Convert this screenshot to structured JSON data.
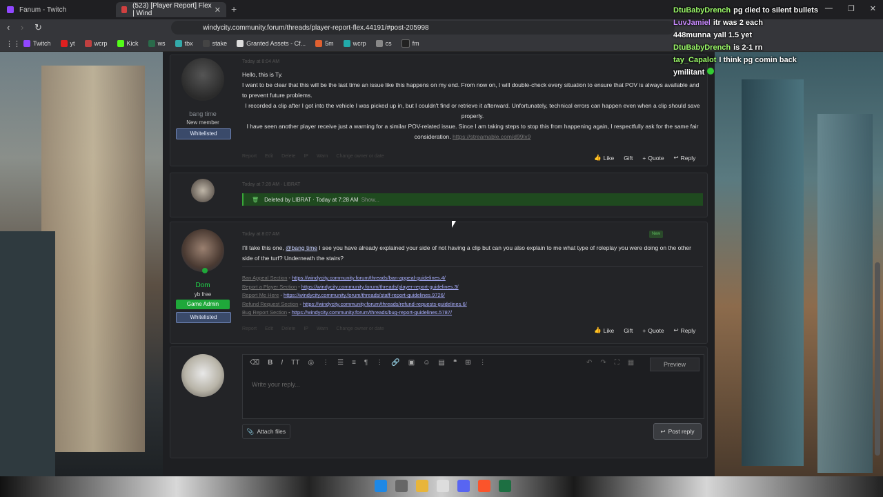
{
  "browser": {
    "tabs": [
      {
        "label": "Fanum - Twitch",
        "color": "#9147ff"
      },
      {
        "label": "(523) [Player Report] Flex | Wind",
        "color": "#d04040"
      }
    ],
    "url": "windycity.community.forum/threads/player-report-flex.44191/#post-205998",
    "bookmarks": [
      {
        "label": "Twitch",
        "color": "#9147ff"
      },
      {
        "label": "yt",
        "color": "#e02020"
      },
      {
        "label": "wcrp",
        "color": "#c04040"
      },
      {
        "label": "Kick",
        "color": "#53fc18"
      },
      {
        "label": "ws",
        "color": "#2a6a4a"
      },
      {
        "label": "tbx",
        "color": "#3aa"
      },
      {
        "label": "stake",
        "color": "#444"
      },
      {
        "label": "Granted Assets - Cf...",
        "color": "#ddd"
      },
      {
        "label": "5m",
        "color": "#e06030"
      },
      {
        "label": "wcrp",
        "color": "#2aa"
      },
      {
        "label": "cs",
        "color": "#888"
      },
      {
        "label": "fm",
        "color": "#222"
      }
    ]
  },
  "posts": [
    {
      "username": "bang time",
      "user_title": "New member",
      "badge": "Whitelisted",
      "meta": "Today at 8:04 AM",
      "paragraphs": [
        "Hello, this is Ty.",
        "I want to be clear that this will be the last time an issue like this happens on my end. From now on, I will double-check every situation to ensure that POV is always available and to prevent future problems.",
        "I recorded a clip after I got into the vehicle I was picked up in, but I couldn't find or retrieve it afterward. Unfortunately, technical errors can happen even when a clip should save properly.",
        "I have seen another player receive just a warning for a similar POV-related issue. Since I am taking steps to stop this from happening again, I respectfully ask for the same fair consideration."
      ],
      "link": "https://streamable.com/d99lx9",
      "small_links": [
        "Report",
        "Edit",
        "Delete",
        "IP",
        "Warn",
        "Change owner or date"
      ],
      "actions": [
        "Like",
        "Gift",
        "Quote",
        "Reply"
      ]
    },
    {
      "meta": "Today at 7:28 AM · LIBRAT",
      "deleted_text": "Deleted by LIBRAT · Today at 7:28 AM",
      "show": "Show..."
    },
    {
      "username": "Dom",
      "user_title": "yb free",
      "badges": [
        "Game Admin",
        "Whitelisted"
      ],
      "meta": "Today at 8:07 AM",
      "new_label": "New",
      "body_pre": "I'll take this one, ",
      "mention": "@bang time",
      "body_post": " I see you have already explained your side of not having a clip but can you also explain to me what type of roleplay you were doing on the other side of the turf? Underneath the stairs?",
      "refs": [
        {
          "label": "Ban Appeal Section",
          "url": "https://windycity.community.forum/threads/ban-appeal-guidelines.4/"
        },
        {
          "label": "Report a Player Section",
          "url": "https://windycity.community.forum/threads/player-report-guidelines.3/"
        },
        {
          "label": "Report Me Here",
          "url": "https://windycity.community.forum/threads/staff-report-guidelines.9726/"
        },
        {
          "label": "Refund Request Section",
          "url": "https://windycity.community.forum/threads/refund-requests-guidelines.6/"
        },
        {
          "label": "Bug Report Section",
          "url": "https://windycity.community.forum/threads/bug-report-guidelines.5787/"
        }
      ],
      "small_links": [
        "Report",
        "Edit",
        "Delete",
        "IP",
        "Warn",
        "Change owner or date"
      ],
      "actions": [
        "Like",
        "Gift",
        "Quote",
        "Reply"
      ]
    }
  ],
  "reply": {
    "placeholder": "Write your reply...",
    "preview": "Preview",
    "attach": "Attach files",
    "post": "Post reply"
  },
  "chat": [
    {
      "name": "DtuBabyDrench",
      "color": "#9dfc6a",
      "msg": "pg died to silent bullets"
    },
    {
      "name": "LuvJamiel",
      "color": "#c98bff",
      "msg": "itr was 2 each"
    },
    {
      "name": "448munna",
      "color": "#ffffff",
      "msg": "yall 1.5 yet"
    },
    {
      "name": "DtuBabyDrench",
      "color": "#9dfc6a",
      "msg": "is 2-1 rn"
    },
    {
      "name": "tay_Capalot",
      "color": "#9dfc6a",
      "msg": "I think pg comin back"
    },
    {
      "name": "ymilitant",
      "color": "#ffffff",
      "msg": ""
    }
  ]
}
